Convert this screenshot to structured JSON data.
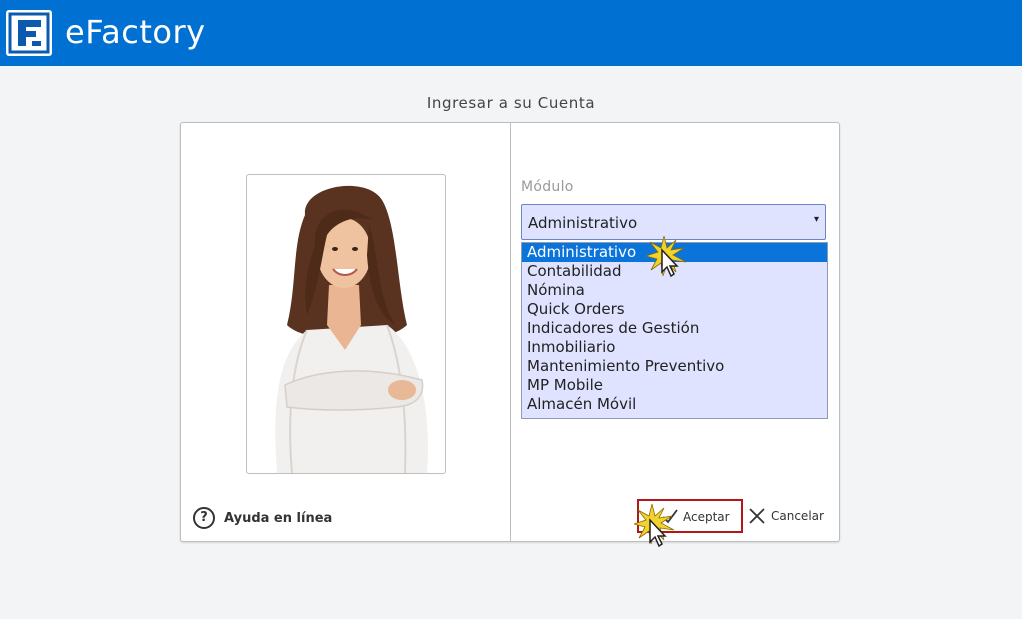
{
  "header": {
    "app_title": "eFactory",
    "logo_icon": "efactory-logo-icon",
    "bg_color": "#0070d2"
  },
  "login": {
    "title": "Ingresar a su Cuenta",
    "help_label": "Ayuda en línea",
    "help_icon_glyph": "?",
    "module": {
      "label": "Módulo",
      "selected": "Administrativo",
      "arrow": "▾",
      "options": [
        "Administrativo",
        "Contabilidad",
        "Nómina",
        "Quick Orders",
        "Indicadores de Gestión",
        "Inmobiliario",
        "Mantenimiento Preventivo",
        "MP Mobile",
        "Almacén Móvil"
      ]
    },
    "accept_label": "Aceptar",
    "cancel_label": "Cancelar"
  }
}
